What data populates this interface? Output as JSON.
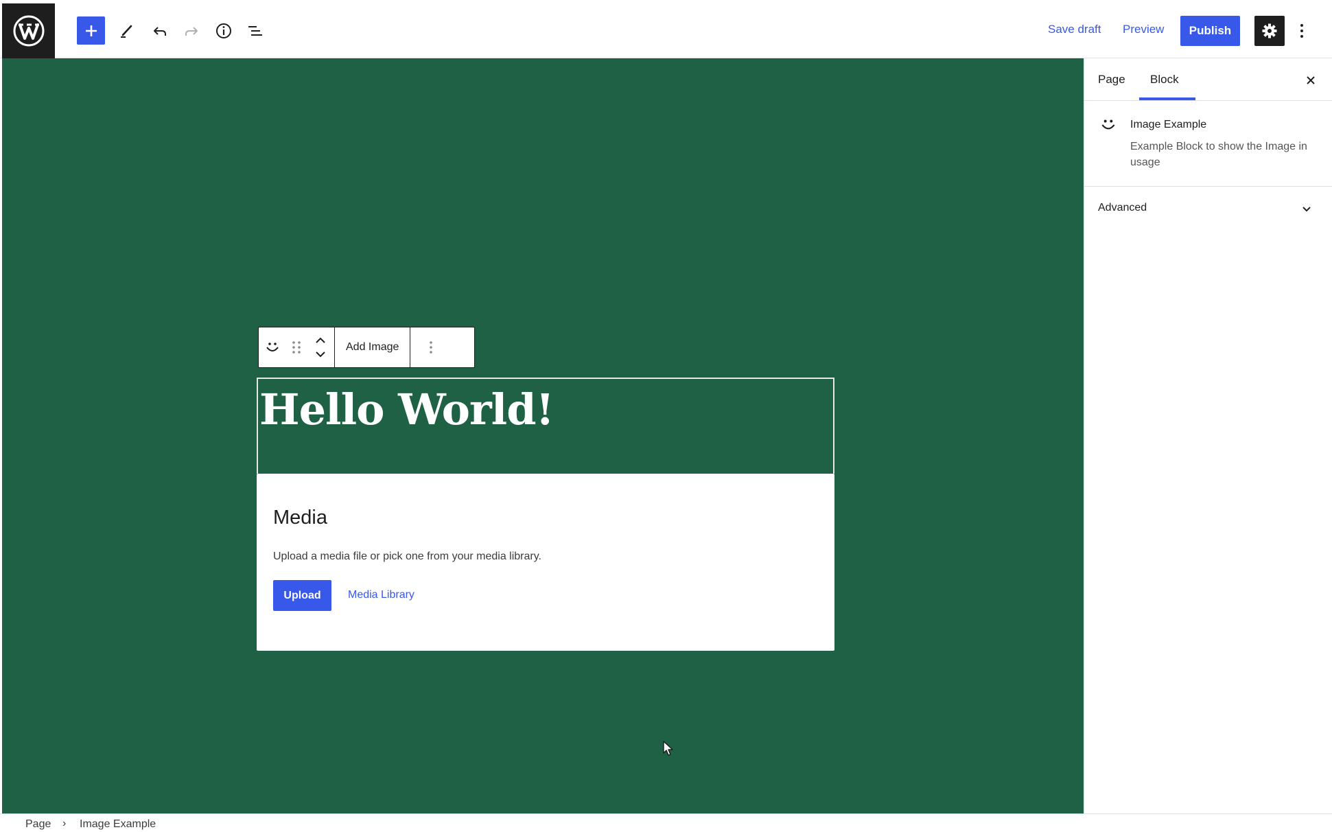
{
  "icons": {
    "wordpress": "wordpress-logo-icon",
    "add": "plus-icon",
    "tools": "pencil-icon",
    "undo": "undo-icon",
    "redo": "redo-icon",
    "details": "info-icon",
    "list_view": "list-view-icon",
    "settings": "gear-icon",
    "options": "vertical-ellipsis-icon",
    "block": "smiley-icon",
    "drag": "drag-handle-icon",
    "move": "move-up-down-icon",
    "close": "close-icon",
    "chevron": "chevron-down-icon",
    "cursor": "mouse-cursor-icon"
  },
  "header": {
    "save_draft": "Save draft",
    "preview": "Preview",
    "publish": "Publish"
  },
  "block_toolbar": {
    "add_image": "Add Image"
  },
  "cover": {
    "title": "Hello World!"
  },
  "placeholder": {
    "title": "Media",
    "instructions": "Upload a media file or pick one from your media library.",
    "upload": "Upload",
    "media_library": "Media Library"
  },
  "sidebar": {
    "tabs": [
      {
        "label": "Page",
        "active": false
      },
      {
        "label": "Block",
        "active": true
      }
    ],
    "block_card": {
      "title": "Image Example",
      "description": "Example Block to show the Image in usage"
    },
    "panels": [
      {
        "title": "Advanced",
        "open": false
      }
    ]
  },
  "breadcrumb": [
    "Page",
    "Image Example"
  ],
  "colors": {
    "accent": "#3858e9",
    "canvas_background": "#1e6145",
    "dark": "#1e1e1e"
  }
}
